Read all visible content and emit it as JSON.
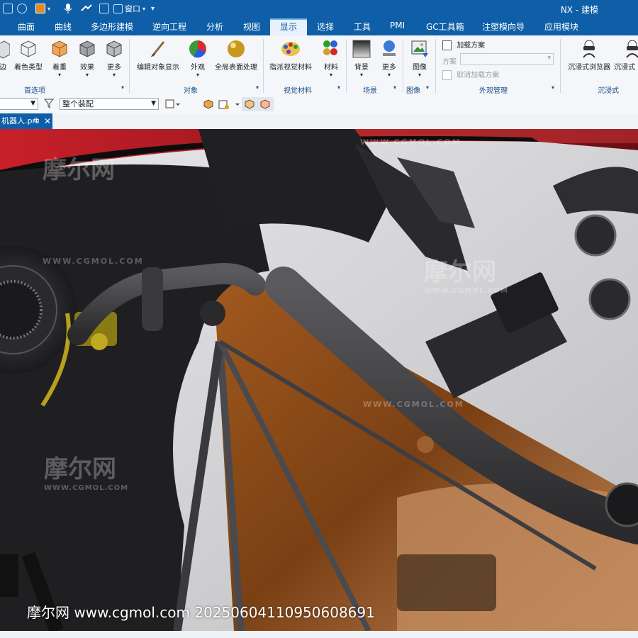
{
  "app": {
    "title": "NX - 建模",
    "window_menu": "窗口"
  },
  "colors": {
    "brand_blue": "#0e5fa8",
    "ribbon_bg": "#f4f6f9",
    "active_tab_text": "#1a5ea6"
  },
  "menu": {
    "tabs": [
      {
        "label": "曲面"
      },
      {
        "label": "曲线"
      },
      {
        "label": "多边形建模"
      },
      {
        "label": "逆向工程"
      },
      {
        "label": "分析"
      },
      {
        "label": "视图"
      },
      {
        "label": "显示",
        "active": true
      },
      {
        "label": "选择"
      },
      {
        "label": "工具"
      },
      {
        "label": "PMI"
      },
      {
        "label": "GC工具箱"
      },
      {
        "label": "注塑模向导"
      },
      {
        "label": "应用模块"
      }
    ]
  },
  "ribbon": {
    "prefs": {
      "edge": "边",
      "shading": "着色类型",
      "coloring": "着重",
      "effects": "效果",
      "more": "更多",
      "group": "首选项"
    },
    "object": {
      "edit_display": "编辑对象显示",
      "appearance": "外观",
      "global_surface": "全局表面处理",
      "group": "对象"
    },
    "visual": {
      "assign_material": "指派视觉材料",
      "material": "材料",
      "group": "视觉材料"
    },
    "scene": {
      "background": "背景",
      "more": "更多",
      "group": "场景"
    },
    "image": {
      "image": "图像",
      "group": "图像"
    },
    "appearance_mgmt": {
      "load_scheme": "加载方案",
      "scheme_label": "方案",
      "unload_scheme": "取消加载方案",
      "group": "外观管理"
    },
    "immersive": {
      "browser": "沉浸式浏览器",
      "browser2": "沉浸式",
      "group": "沉浸式"
    }
  },
  "toolbar": {
    "selection_filter": "整个装配"
  },
  "file_tab": {
    "name": "机器人.prt"
  },
  "watermarks": {
    "logo": "摩尔网",
    "site": "WWW.CGMOL.COM",
    "bottom": "摩尔网 www.cgmol.com 20250604110950608691"
  }
}
